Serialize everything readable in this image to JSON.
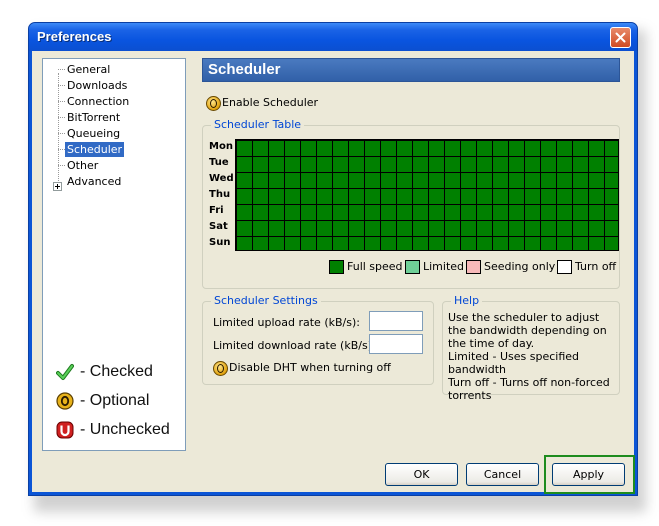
{
  "window": {
    "title": "Preferences"
  },
  "tree": {
    "items": [
      {
        "label": "General"
      },
      {
        "label": "Downloads"
      },
      {
        "label": "Connection"
      },
      {
        "label": "BitTorrent"
      },
      {
        "label": "Queueing"
      },
      {
        "label": "Scheduler",
        "selected": true
      },
      {
        "label": "Other"
      },
      {
        "label": "Advanced",
        "expandable": true
      }
    ]
  },
  "legend": {
    "checked": "- Checked",
    "optional": "- Optional",
    "unchecked": "- Unchecked"
  },
  "panel": {
    "title": "Scheduler",
    "enable_label": "Enable Scheduler",
    "table_group": "Scheduler Table",
    "days": [
      "Mon",
      "Tue",
      "Wed",
      "Thu",
      "Fri",
      "Sat",
      "Sun"
    ],
    "grid": {
      "columns": 24,
      "rows": 7,
      "fill_state": "Full speed"
    },
    "keys": [
      {
        "label": "Full speed",
        "color": "#008000"
      },
      {
        "label": "Limited",
        "color": "#6fcf97"
      },
      {
        "label": "Seeding only",
        "color": "#f7b9b9"
      },
      {
        "label": "Turn off",
        "color": "#ffffff"
      }
    ],
    "settings_group": "Scheduler Settings",
    "upload_label": "Limited upload rate (kB/s):",
    "upload_value": "",
    "download_label": "Limited download rate (kB/s):",
    "download_value": "",
    "dht_label": "Disable DHT when turning off",
    "help_group": "Help",
    "help_lines": [
      "Use the scheduler to adjust the bandwidth depending on the time of day.",
      "Limited - Uses specified bandwidth",
      "Turn off - Turns off non-forced torrents"
    ]
  },
  "buttons": {
    "ok": "OK",
    "cancel": "Cancel",
    "apply": "Apply"
  },
  "colors": {
    "titlebar": "#0b55d6",
    "highlight": "#316ac5",
    "apply_outline": "#1e8c1e"
  }
}
